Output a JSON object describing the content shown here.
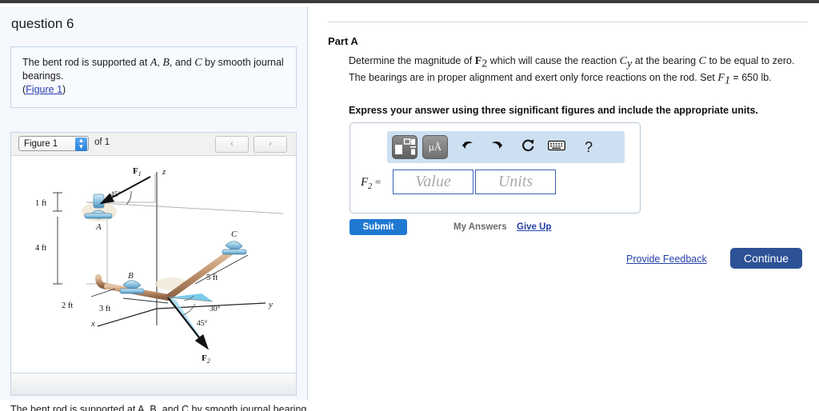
{
  "left": {
    "question_title": "question 6",
    "statement_pre": "The bent rod is supported at ",
    "statement_a": "A",
    "statement_mid1": ", ",
    "statement_b": "B",
    "statement_mid2": ", and ",
    "statement_c": "C",
    "statement_post": " by smooth journal bearings.",
    "figure_link": "Figure 1",
    "paren_open": "(",
    "paren_close": ")",
    "figure_select_value": "Figure 1",
    "figure_count_label": "of 1",
    "prev_label": "‹",
    "next_label": "›",
    "cut_off_text": "The bent rod is supported at A, B, and C by smooth journal bearings."
  },
  "figure": {
    "labels": {
      "F1": "F",
      "F1_sub": "1",
      "F2": "F",
      "F2_sub": "2",
      "angle_45_top": "45°",
      "angle_30": "30°",
      "angle_45_bottom": "45°",
      "dim_1ft": "1 ft",
      "dim_4ft": "4 ft",
      "dim_2ft": "2 ft",
      "dim_3ft": "3 ft",
      "dim_5ft": "5 ft",
      "bearing_A": "A",
      "bearing_B": "B",
      "bearing_C": "C",
      "axis_x": "x",
      "axis_y": "y",
      "axis_z": "z"
    },
    "colors": {
      "rod": "#c08f6a",
      "bearing": "#8fc4e0",
      "shade": "#6ec6e8",
      "axis": "#5a5a5a"
    }
  },
  "right": {
    "part_label": "Part A",
    "prompt_1": "Determine the magnitude of ",
    "prompt_F2": "F",
    "prompt_F2_sub": "2",
    "prompt_2": " which will cause the reaction ",
    "prompt_C": "C",
    "prompt_C_sub": "y",
    "prompt_3": " at the bearing ",
    "prompt_C2": "C",
    "prompt_4": " to be equal to zero. The bearings are in proper alignment and exert only force reactions on the rod. Set ",
    "prompt_F1": "F",
    "prompt_F1_sub": "1",
    "prompt_5": " = 650 lb.",
    "instruction": "Express your answer using three significant figures and include the appropriate units.",
    "answer_symbol": "F",
    "answer_symbol_sub": "2",
    "answer_equals": "=",
    "value_placeholder": "Value",
    "units_placeholder": "Units",
    "toolbar": {
      "fraction_icon": "fraction-template-icon",
      "units_icon": "μÅ",
      "undo_icon": "↩",
      "redo_icon": "↪",
      "reset_icon": "↻",
      "keyboard_icon": "keyboard-icon",
      "help_icon": "?"
    },
    "submit_label": "Submit",
    "my_answers_label": "My Answers",
    "give_up_label": "Give Up",
    "provide_feedback_label": "Provide Feedback",
    "continue_label": "Continue"
  },
  "colors": {
    "submit_blue": "#1f78d1",
    "continue_blue": "#2d5196",
    "link_blue": "#2540a8",
    "panel_bg": "#f5f8fd",
    "toolbar_bg": "#cde0f2"
  }
}
